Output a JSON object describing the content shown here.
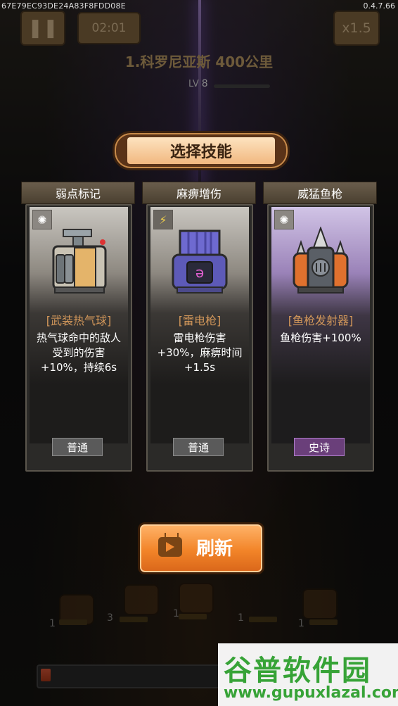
{
  "debug_id": "67E79EC93DE24A83F8FDD08E",
  "version": "0.4.7.66",
  "hud": {
    "pause_icon": "pause-icon",
    "timer": "02:01",
    "speed": "x1.5"
  },
  "stage": {
    "title": "1.科罗尼亚斯 400公里",
    "level_label": "LV",
    "level_value": "8"
  },
  "select_skill_title": "选择技能",
  "cards": [
    {
      "header": "弱点标记",
      "type_icon": "target-icon",
      "weapon_name": "[武装热气球]",
      "description": "热气球命中的敌人受到的伤害+10%，持续6s",
      "rarity": "普通"
    },
    {
      "header": "麻痹增伤",
      "type_icon": "lightning-icon",
      "weapon_name": "[雷电枪]",
      "description": "雷电枪伤害+30%，麻痹时间+1.5s",
      "rarity": "普通"
    },
    {
      "header": "威猛鱼枪",
      "type_icon": "target-icon",
      "weapon_name": "[鱼枪发射器]",
      "description": "鱼枪伤害+100%",
      "rarity": "史诗"
    }
  ],
  "refresh": {
    "icon": "video-ad-icon",
    "label": "刷新"
  },
  "turret_counts": [
    "1",
    "3",
    "1",
    "1",
    "1"
  ],
  "watermark": {
    "cn": "谷普软件园",
    "url": "www.gupuxlazal.com"
  },
  "colors": {
    "accent_orange": "#f28428",
    "weapon_name": "#d2975a",
    "epic_purple": "#6a3f7a",
    "watermark_green": "#37a337"
  }
}
